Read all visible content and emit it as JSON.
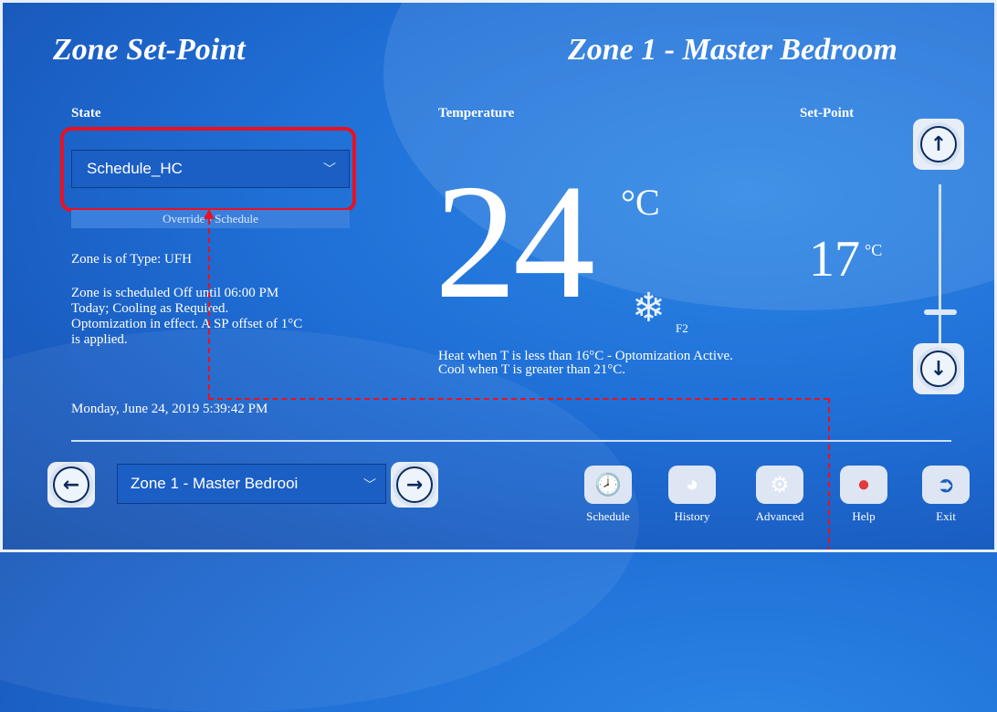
{
  "header": {
    "page_title": "Zone Set-Point",
    "zone_title": "Zone 1 - Master Bedroom"
  },
  "state": {
    "label": "State",
    "selected": "Schedule_HC",
    "override_label": "Override - Schedule"
  },
  "info": {
    "zone_type": "Zone is of Type: UFH",
    "schedule_lines": [
      "Zone is scheduled Off until 06:00 PM",
      "Today; Cooling as Required.",
      "Optomization in effect. A SP offset of 1°C",
      "is applied."
    ],
    "datetime": "Monday, June 24, 2019 5:39:42 PM"
  },
  "temperature": {
    "label": "Temperature",
    "value": "24",
    "unit": "°C",
    "mode_icon": "snowflake-icon",
    "mode_label": "F2",
    "note_lines": [
      "Heat when T is less than  16°C - Optomization Active.",
      "Cool when T is greater than 21°C."
    ]
  },
  "setpoint": {
    "label": "Set-Point",
    "value": "17",
    "unit": "°C",
    "level_fraction": 0.78
  },
  "footer": {
    "zone_select": "Zone 1 - Master Bedrooi",
    "tools": [
      {
        "label": "Schedule",
        "icon": "clock-icon"
      },
      {
        "label": "History",
        "icon": "pie-chart-icon"
      },
      {
        "label": "Advanced",
        "icon": "settings-panel-icon"
      },
      {
        "label": "Help",
        "icon": "help-icon"
      },
      {
        "label": "Exit",
        "icon": "exit-icon"
      }
    ]
  },
  "colors": {
    "background": "#1f6fd6",
    "highlight": "#e81123",
    "text": "#ffffff"
  }
}
